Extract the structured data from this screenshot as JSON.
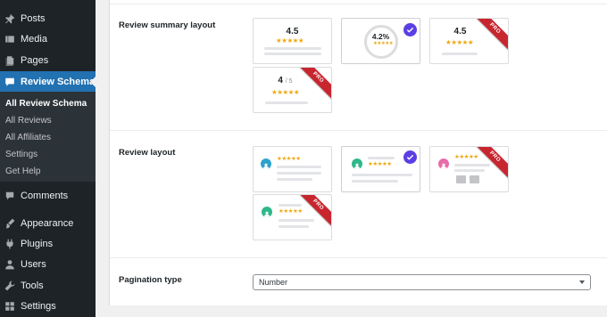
{
  "sidebar": {
    "items": [
      {
        "label": "Posts",
        "icon": "pin-icon"
      },
      {
        "label": "Media",
        "icon": "media-icon"
      },
      {
        "label": "Pages",
        "icon": "page-icon"
      },
      {
        "label": "Review Schema",
        "icon": "review-icon"
      },
      {
        "label": "Comments",
        "icon": "comment-icon"
      },
      {
        "label": "Appearance",
        "icon": "brush-icon"
      },
      {
        "label": "Plugins",
        "icon": "plug-icon"
      },
      {
        "label": "Users",
        "icon": "users-icon"
      },
      {
        "label": "Tools",
        "icon": "wrench-icon"
      },
      {
        "label": "Settings",
        "icon": "settings-icon"
      }
    ],
    "submenu": [
      "All Review Schema",
      "All Reviews",
      "All Affiliates",
      "Settings",
      "Get Help"
    ]
  },
  "settings": {
    "summary_label": "Review summary layout",
    "review_label": "Review layout",
    "pagination_label": "Pagination type"
  },
  "summary_layouts": {
    "card1": {
      "score": "4.5"
    },
    "card2": {
      "score": "4.2%",
      "selected": true
    },
    "card3": {
      "score": "4.5",
      "badge": "PRO"
    },
    "card4": {
      "score": "4",
      "slash": "/ 5",
      "badge": "PRO"
    }
  },
  "review_layouts": {
    "card1": {
      "avatar_color": "#2ea2cc"
    },
    "card2": {
      "avatar_color": "#2fb889",
      "selected": true
    },
    "card3": {
      "avatar_color": "#e76ca7",
      "badge": "PRO"
    },
    "card4": {
      "avatar_color": "#2fb889",
      "badge": "PRO"
    }
  },
  "stars": "★★★★★",
  "pagination": {
    "value": "Number"
  },
  "colors": {
    "accent": "#2271b1",
    "check": "#5b3fe4",
    "pro_ribbon": "#c8262f",
    "star": "#f0a814"
  }
}
